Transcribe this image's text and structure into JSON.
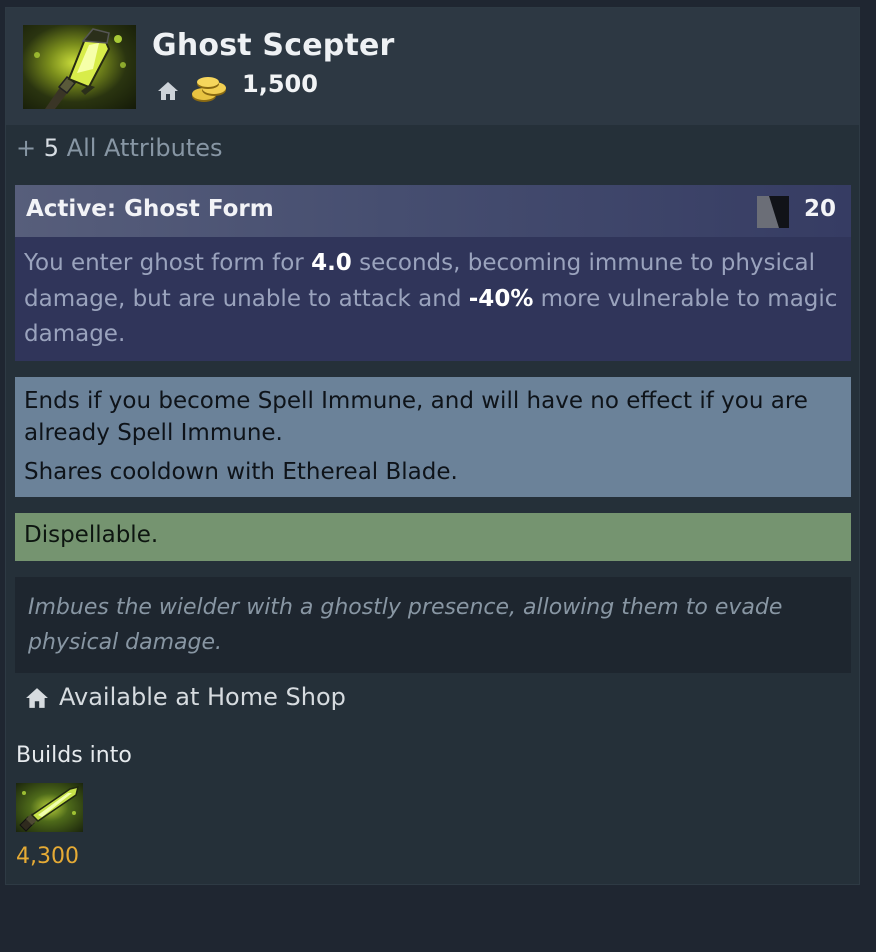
{
  "item": {
    "name": "Ghost Scepter",
    "icon": "ghost-scepter-item-icon",
    "cost": "1,500",
    "shop_icon": "home-icon",
    "gold_icon": "gold-coins-icon"
  },
  "attribute": {
    "prefix": "+",
    "value": "5",
    "label": "All Attributes"
  },
  "active": {
    "title": "Active: Ghost Form",
    "cooldown_icon": "cooldown-icon",
    "cooldown": "20",
    "desc": {
      "p1": "You enter ghost form for ",
      "duration": "4.0",
      "p2": " seconds, becoming immune to physical damage, but are unable to attack and ",
      "magic_amp": "-40%",
      "p3": " more vulnerable to magic damage."
    }
  },
  "notes": [
    "Ends if you become Spell Immune, and will have no effect if you are already Spell Immune.",
    "Shares cooldown with Ethereal Blade."
  ],
  "dispel": "Dispellable.",
  "lore": "Imbues the wielder with a ghostly presence, allowing them to evade physical damage.",
  "availability": {
    "icon": "home-icon",
    "text": "Available at Home Shop"
  },
  "builds_into": {
    "label": "Builds into",
    "items": [
      {
        "icon": "ethereal-blade-item-icon",
        "cost": "4,300"
      }
    ]
  },
  "colors": {
    "background": "#1f2631",
    "card": "#253039",
    "active_panel": "#30355a",
    "note_panel": "#6b8299",
    "dispel_panel": "#759470",
    "gold_text": "#e6ab35"
  }
}
